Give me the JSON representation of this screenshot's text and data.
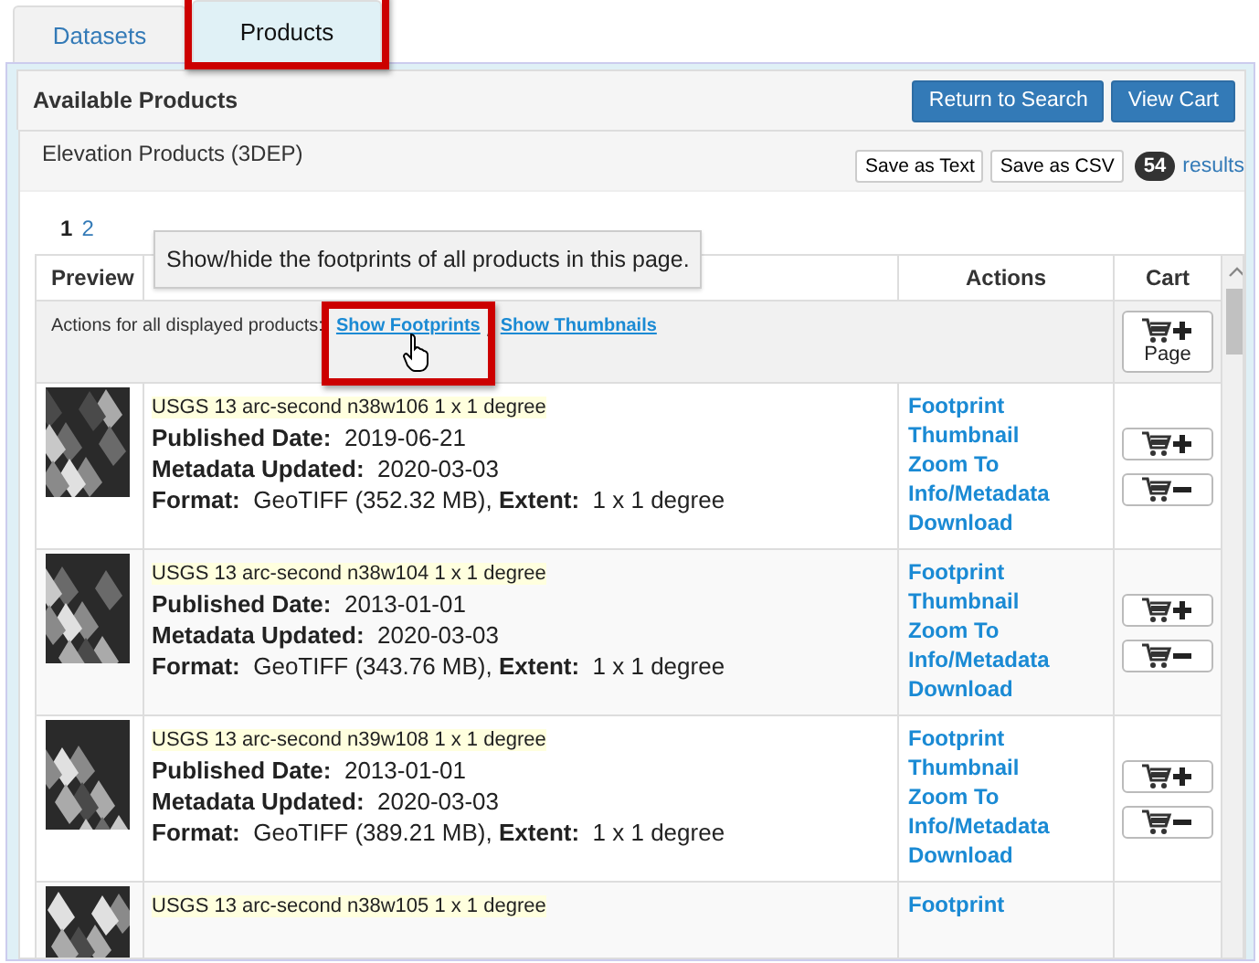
{
  "tabs": [
    {
      "label": "Datasets",
      "selected": false,
      "highlighted": false
    },
    {
      "label": "Products",
      "selected": true,
      "highlighted": true
    }
  ],
  "panel_title": "Available Products",
  "panel_buttons": [
    "Return to Search",
    "View Cart"
  ],
  "section": {
    "title": "Elevation Products (3DEP)",
    "save_buttons": [
      "Save as Text",
      "Save as CSV"
    ],
    "count": "54",
    "count_label": "results"
  },
  "pages": [
    {
      "label": "1",
      "selected": true
    },
    {
      "label": "2",
      "selected": false
    }
  ],
  "tooltip": "Show/hide the footprints of all products in this page.",
  "table": {
    "columns": [
      "Preview",
      "Actions",
      "Cart"
    ],
    "bulk_actions": {
      "label": "Actions for all displayed products:",
      "links": [
        {
          "label": "Show Footprints",
          "highlighted": true
        },
        {
          "label": "Show Thumbnails",
          "highlighted": false
        }
      ],
      "cart_button": "Page"
    },
    "rows": [
      {
        "title": "USGS 13 arc-second n38w106 1 x 1 degree",
        "lines": [
          "**Published Date:**  2019-06-21",
          "**Metadata Updated:**  2020-03-03",
          "**Format:**  GeoTIFF (352.32 MB), **Extent:**  1 x 1 degree"
        ],
        "actions": [
          "Footprint",
          "Thumbnail",
          "Zoom To",
          "Info/Metadata",
          "Download"
        ],
        "cart": [
          {
            "kind": "add"
          },
          {
            "kind": "remove"
          }
        ]
      },
      {
        "title": "USGS 13 arc-second n38w104 1 x 1 degree",
        "lines": [
          "**Published Date:**  2013-01-01",
          "**Metadata Updated:**  2020-03-03",
          "**Format:**  GeoTIFF (343.76 MB), **Extent:**  1 x 1 degree"
        ],
        "actions": [
          "Footprint",
          "Thumbnail",
          "Zoom To",
          "Info/Metadata",
          "Download"
        ],
        "cart": [
          {
            "kind": "add"
          },
          {
            "kind": "remove"
          }
        ]
      },
      {
        "title": "USGS 13 arc-second n39w108 1 x 1 degree",
        "lines": [
          "**Published Date:**  2013-01-01",
          "**Metadata Updated:**  2020-03-03",
          "**Format:**  GeoTIFF (389.21 MB), **Extent:**  1 x 1 degree"
        ],
        "actions": [
          "Footprint",
          "Thumbnail",
          "Zoom To",
          "Info/Metadata",
          "Download"
        ],
        "cart": [
          {
            "kind": "add"
          },
          {
            "kind": "remove"
          }
        ]
      },
      {
        "title": "USGS 13 arc-second n38w105 1 x 1 degree",
        "lines": [],
        "actions": [
          "Footprint"
        ],
        "cart": []
      }
    ]
  }
}
